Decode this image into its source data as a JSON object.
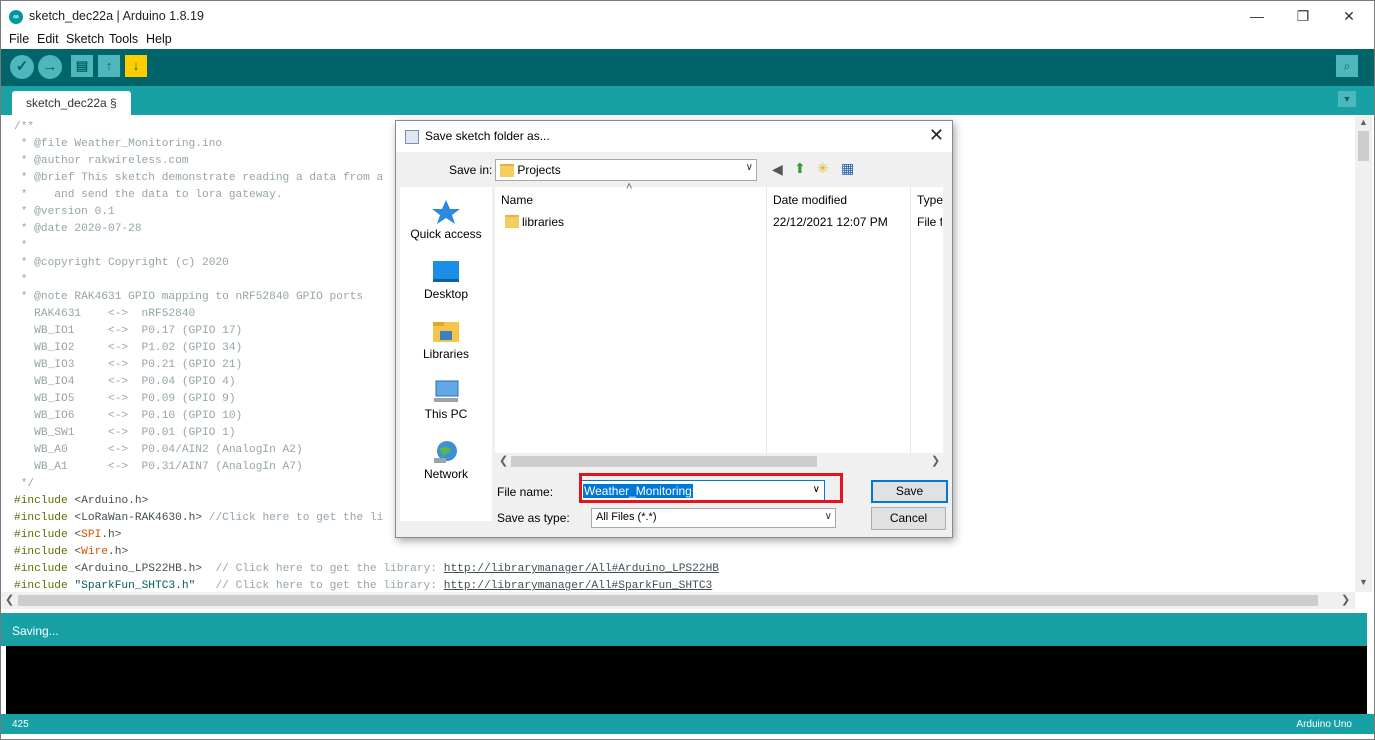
{
  "window": {
    "title": "sketch_dec22a | Arduino 1.8.19",
    "minimize_glyph": "—",
    "maximize_glyph": "❐",
    "close_glyph": "✕"
  },
  "menu": [
    "File",
    "Edit",
    "Sketch",
    "Tools",
    "Help"
  ],
  "toolbar": {
    "verify_glyph": "✓",
    "upload_glyph": "→",
    "new_glyph": "▤",
    "open_glyph": "↑",
    "save_glyph": "↓",
    "serial_glyph": "⌕"
  },
  "tab": {
    "label": "sketch_dec22a §",
    "menu_glyph": "▼"
  },
  "editor": {
    "comment_lines": [
      "/**",
      " * @file Weather_Monitoring.ino",
      " * @author rakwireless.com",
      " * @brief This sketch demonstrate reading a data from a",
      " *    and send the data to lora gateway.",
      " * @version 0.1",
      " * @date 2020-07-28",
      " *",
      " * @copyright Copyright (c) 2020",
      " *",
      " * @note RAK4631 GPIO mapping to nRF52840 GPIO ports",
      "   RAK4631    <->  nRF52840",
      "   WB_IO1     <->  P0.17 (GPIO 17)",
      "   WB_IO2     <->  P1.02 (GPIO 34)",
      "   WB_IO3     <->  P0.21 (GPIO 21)",
      "   WB_IO4     <->  P0.04 (GPIO 4)",
      "   WB_IO5     <->  P0.09 (GPIO 9)",
      "   WB_IO6     <->  P0.10 (GPIO 10)",
      "   WB_SW1     <->  P0.01 (GPIO 1)",
      "   WB_A0      <->  P0.04/AIN2 (AnalogIn A2)",
      "   WB_A1      <->  P0.31/AIN7 (AnalogIn A7)",
      " */"
    ],
    "includes": [
      {
        "kw": "#include",
        "pre": " <",
        "name": "Arduino",
        "post": ".h>",
        "comment": "",
        "link": ""
      },
      {
        "kw": "#include",
        "pre": " <",
        "name": "LoRaWan-RAK4630",
        "post": ".h>",
        "comment": " //Click here to get the li",
        "link": ""
      },
      {
        "kw": "#include",
        "pre": " <",
        "name": "SPI",
        "post": ".h>",
        "comment": "",
        "link": ""
      },
      {
        "kw": "#include",
        "pre": " <",
        "name": "Wire",
        "post": ".h>",
        "comment": "",
        "link": ""
      },
      {
        "kw": "#include",
        "pre": " <",
        "name": "Arduino_LPS22HB",
        "post": ".h>",
        "comment": "  // Click here to get the library: ",
        "link": "http://librarymanager/All#Arduino_LPS22HB"
      },
      {
        "kw": "#include",
        "pre": " ",
        "name": "\"SparkFun_SHTC3.h\"",
        "post": "",
        "comment": "   // Click here to get the library: ",
        "link": "http://librarymanager/All#SparkFun_SHTC3"
      }
    ]
  },
  "scroll": {
    "up": "▲",
    "down": "▼",
    "left": "❮",
    "right": "❯"
  },
  "status": {
    "message": "Saving..."
  },
  "footer": {
    "line": "425",
    "board": "Arduino Uno"
  },
  "dialog": {
    "title": "Save sketch folder as...",
    "close_glyph": "✕",
    "save_in_label": "Save in:",
    "save_in_value": "Projects",
    "dropdown_glyph": "∨",
    "nav": {
      "back": "◀",
      "up": "⬆",
      "new_folder": "✳",
      "view": "▦"
    },
    "places": [
      "Quick access",
      "Desktop",
      "Libraries",
      "This PC",
      "Network"
    ],
    "columns": [
      "Name",
      "Date modified",
      "Type"
    ],
    "sort_glyph": "˄",
    "files": [
      {
        "name": "libraries",
        "date": "22/12/2021 12:07 PM",
        "type": "File fo"
      }
    ],
    "file_name_label": "File name:",
    "file_name_value": "Weather_Monitoring",
    "save_as_type_label": "Save as type:",
    "save_as_type_value": "All Files (*.*)",
    "save_button": "Save",
    "cancel_button": "Cancel"
  },
  "colors": {
    "toolbar_bg": "#006468",
    "tab_bar_bg": "#17a1a5",
    "console_bg": "#000000",
    "highlight_border": "#e3141e",
    "selection": "#0078d7"
  }
}
